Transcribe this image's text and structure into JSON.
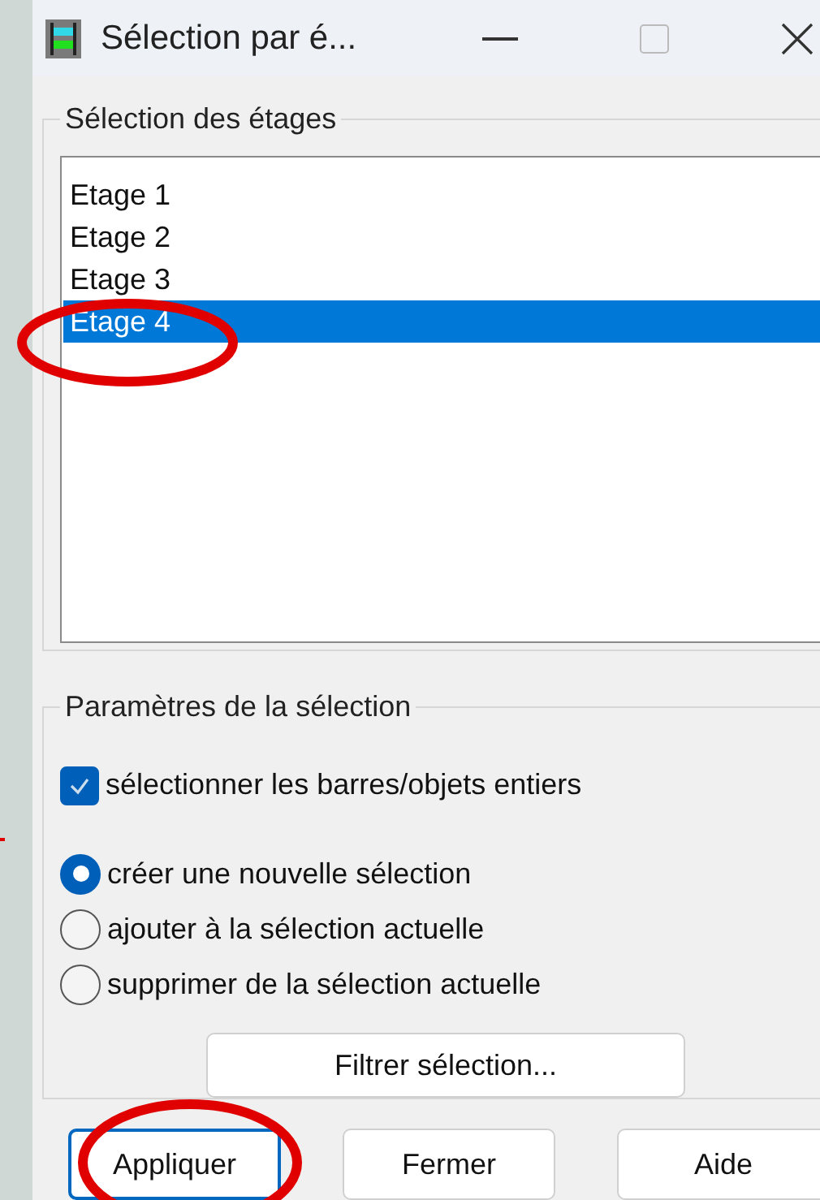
{
  "window": {
    "title": "Sélection par é..."
  },
  "floors_group": {
    "label": "Sélection des étages",
    "items": [
      {
        "label": "Etage 1",
        "selected": false
      },
      {
        "label": "Etage 2",
        "selected": false
      },
      {
        "label": "Etage 3",
        "selected": false
      },
      {
        "label": "Etage 4",
        "selected": true
      }
    ]
  },
  "params_group": {
    "label": "Paramètres de la sélection",
    "checkbox": {
      "label": "sélectionner les barres/objets entiers",
      "checked": true
    },
    "radios": [
      {
        "label": "créer une nouvelle sélection",
        "selected": true
      },
      {
        "label": "ajouter à la sélection actuelle",
        "selected": false
      },
      {
        "label": "supprimer de la sélection actuelle",
        "selected": false
      }
    ],
    "filter_button": "Filtrer sélection..."
  },
  "buttons": [
    {
      "label": "Appliquer",
      "default": true
    },
    {
      "label": "Fermer",
      "default": false
    },
    {
      "label": "Aide",
      "default": false
    }
  ]
}
